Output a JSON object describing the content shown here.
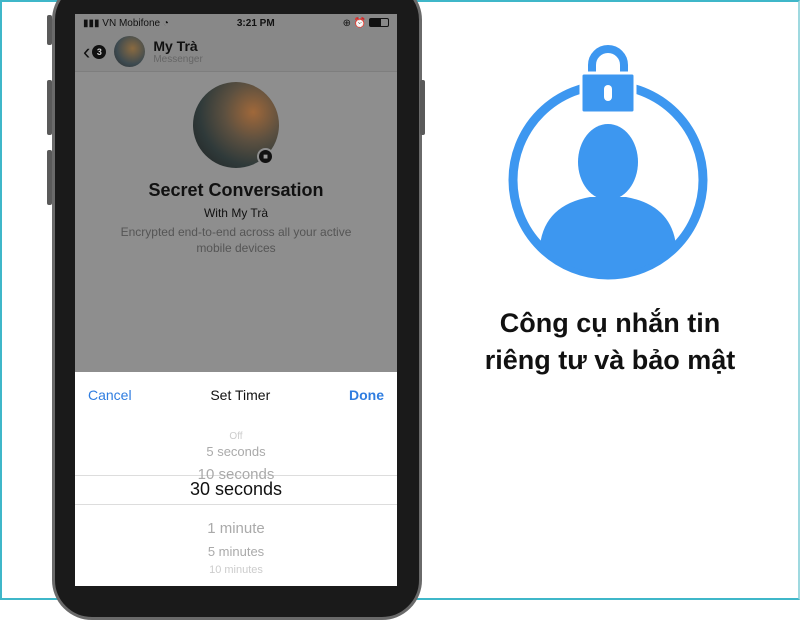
{
  "status": {
    "carrier": "VN Mobifone",
    "time": "3:21 PM"
  },
  "header": {
    "back_count": "3",
    "name": "My Trà",
    "subtitle": "Messenger"
  },
  "conversation": {
    "title": "Secret Conversation",
    "with": "With My Trà",
    "description_line1": "Encrypted end-to-end across all your active",
    "description_line2": "mobile devices"
  },
  "timer": {
    "cancel": "Cancel",
    "title": "Set Timer",
    "done": "Done",
    "options": [
      "Off",
      "5 seconds",
      "10 seconds",
      "30 seconds",
      "1 minute",
      "5 minutes",
      "10 minutes"
    ],
    "selected": "30 seconds"
  },
  "promo": {
    "line1": "Công cụ nhắn tin",
    "line2": "riêng tư và bảo mật",
    "icon": "lock-user-icon",
    "accent": "#3d97f0"
  }
}
